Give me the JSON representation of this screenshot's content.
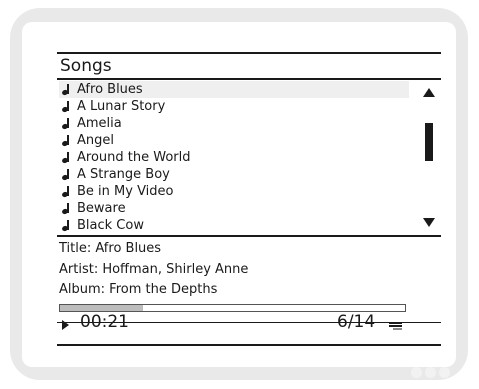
{
  "header": {
    "title": "Songs"
  },
  "songs": [
    {
      "label": "Afro Blues",
      "selected": true
    },
    {
      "label": "A Lunar Story"
    },
    {
      "label": "Amelia"
    },
    {
      "label": "Angel"
    },
    {
      "label": "Around the World"
    },
    {
      "label": "A Strange Boy"
    },
    {
      "label": "Be in My Video"
    },
    {
      "label": "Beware"
    },
    {
      "label": "Black Cow"
    }
  ],
  "now_playing": {
    "title": "Title: Afro Blues",
    "artist": "Artist: Hoffman, Shirley Anne",
    "album": "Album: From the Depths"
  },
  "playback": {
    "progress": 0.24,
    "elapsed": "00:21",
    "track_count": "6/14"
  },
  "icons": {
    "list_item": "music-note-icon",
    "scroll_up": "up-arrow-icon",
    "scroll_down": "down-arrow-icon",
    "state": "play-icon",
    "mode": "repeat-icon"
  },
  "colors": {
    "ink": "#1a1a1a",
    "selection": "#efefef",
    "progress": "#bdbdbd",
    "bezel": "#e9e9e9"
  }
}
